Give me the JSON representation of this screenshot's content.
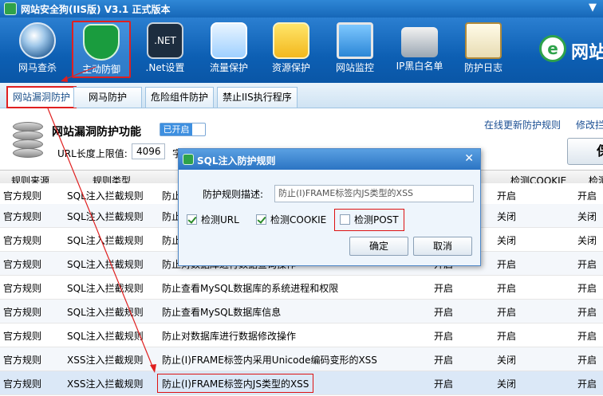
{
  "window": {
    "title": "网站安全狗(IIS版) V3.1 正式版本",
    "right_glyph": "▼"
  },
  "toolbar": {
    "items": [
      {
        "label": "网马查杀",
        "icon": "globe-scan-icon"
      },
      {
        "label": "主动防御",
        "icon": "shield-icon"
      },
      {
        "label": ".Net设置",
        "icon": "dotnet-icon",
        "icon_text": ".NET"
      },
      {
        "label": "流量保护",
        "icon": "traffic-chart-icon"
      },
      {
        "label": "资源保护",
        "icon": "folder-icon"
      },
      {
        "label": "网站监控",
        "icon": "monitor-icon"
      },
      {
        "label": "IP黑白名单",
        "icon": "router-icon"
      },
      {
        "label": "防护日志",
        "icon": "clipboard-icon"
      }
    ],
    "brand_text": "网站",
    "brand_logo_letter": "e"
  },
  "tabs": [
    "网站漏洞防护",
    "网马防护",
    "危险组件防护",
    "禁止IIS执行程序"
  ],
  "header": {
    "title": "网站漏洞防护功能",
    "toggle_label": "已开启",
    "url_label": "URL长度上限值:",
    "url_value": "4096",
    "url_suffix": "字",
    "link_update": "在线更新防护规则",
    "link_modify": "修改拦",
    "big_button": "保"
  },
  "table": {
    "headers": [
      "规则来源",
      "规则类型",
      "",
      "",
      "检测COOKIE",
      "检测"
    ],
    "rows": [
      {
        "src": "官方规则",
        "type": "SQL注入拦截规则",
        "name": "防止",
        "a": "",
        "b": "开启",
        "c": "开启"
      },
      {
        "src": "官方规则",
        "type": "SQL注入拦截规则",
        "name": "防止",
        "a": "",
        "b": "关闭",
        "c": "关闭"
      },
      {
        "src": "官方规则",
        "type": "SQL注入拦截规则",
        "name": "防止",
        "a": "",
        "b": "关闭",
        "c": "关闭"
      },
      {
        "src": "官方规则",
        "type": "SQL注入拦截规则",
        "name": "防止对数据库进行数据查询操作",
        "a": "开启",
        "b": "开启",
        "c": "开启"
      },
      {
        "src": "官方规则",
        "type": "SQL注入拦截规则",
        "name": "防止查看MySQL数据库的系统进程和权限",
        "a": "开启",
        "b": "开启",
        "c": "开启"
      },
      {
        "src": "官方规则",
        "type": "SQL注入拦截规则",
        "name": "防止查看MySQL数据库信息",
        "a": "开启",
        "b": "开启",
        "c": "开启"
      },
      {
        "src": "官方规则",
        "type": "SQL注入拦截规则",
        "name": "防止对数据库进行数据修改操作",
        "a": "开启",
        "b": "开启",
        "c": "开启"
      },
      {
        "src": "官方规则",
        "type": "XSS注入拦截规则",
        "name": "防止(I)FRAME标签内采用Unicode编码变形的XSS",
        "a": "开启",
        "b": "关闭",
        "c": "开启"
      },
      {
        "src": "官方规则",
        "type": "XSS注入拦截规则",
        "name": "防止(I)FRAME标签内JS类型的XSS",
        "a": "开启",
        "b": "关闭",
        "c": "开启"
      }
    ]
  },
  "dialog": {
    "title": "SQL注入防护规则",
    "close_glyph": "✕",
    "desc_label": "防护规则描述:",
    "desc_value": "防止(I)FRAME标签内JS类型的XSS",
    "check_url": "检测URL",
    "check_cookie": "检测COOKIE",
    "check_post": "检测POST",
    "ok": "确定",
    "cancel": "取消"
  },
  "colors": {
    "toolbar": "#0d5fb3",
    "highlight": "#e02020",
    "title_bar": "#1667b8"
  }
}
